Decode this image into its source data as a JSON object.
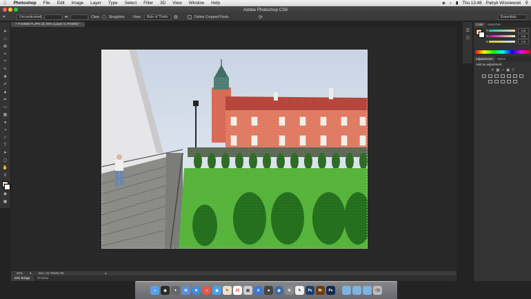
{
  "menubar": {
    "app_name": "Photoshop",
    "items": [
      "File",
      "Edit",
      "Image",
      "Layer",
      "Type",
      "Select",
      "Filter",
      "3D",
      "View",
      "Window",
      "Help"
    ],
    "clock": "Thu 13:48",
    "user": "Patryk Wisniewski"
  },
  "window": {
    "title": "Adobe Photoshop CS6"
  },
  "options_bar": {
    "mode_select": "Unconstrained",
    "field_1": "",
    "field_2": "",
    "clear_label": "Clear",
    "straighten_label": "Straighten",
    "view_label": "View:",
    "view_select": "Rule of Thirds",
    "delete_cropped_label": "Delete Cropped Pixels",
    "workspace_select": "Essentials"
  },
  "document": {
    "tab_title": "P1000677.JPG @ 25% (Layer 0, RGB/8) *"
  },
  "status_bar": {
    "zoom": "25%",
    "doc_size": "Doc: 22,7M/45,7M"
  },
  "bottom_tabs": [
    "Mini Bridge",
    "Timeline"
  ],
  "color_panel": {
    "tabs": [
      "Color",
      "Swatches"
    ],
    "r_label": "R",
    "g_label": "G",
    "b_label": "B",
    "r_value": "215",
    "g_value": "215",
    "b_value": "179",
    "fg_color": "#f2c6a0",
    "bg_color": "#ffffff"
  },
  "adjustments_panel": {
    "tabs": [
      "Adjustments",
      "Styles"
    ],
    "heading": "Add an adjustment"
  },
  "dock_icons": [
    "finder-icon",
    "dashboard-icon",
    "launchpad-icon",
    "mail-icon",
    "safari-icon",
    "calendar-icon",
    "itunes-icon",
    "photos-icon",
    "chrome-icon",
    "system-preferences-icon",
    "app-store-icon",
    "textedit-icon",
    "photoshop-icon",
    "bridge-icon",
    "photoshop-cs6-icon",
    "folder-icon",
    "folder-icon",
    "folder-icon",
    "trash-icon"
  ],
  "accent": "#3d8ee0"
}
